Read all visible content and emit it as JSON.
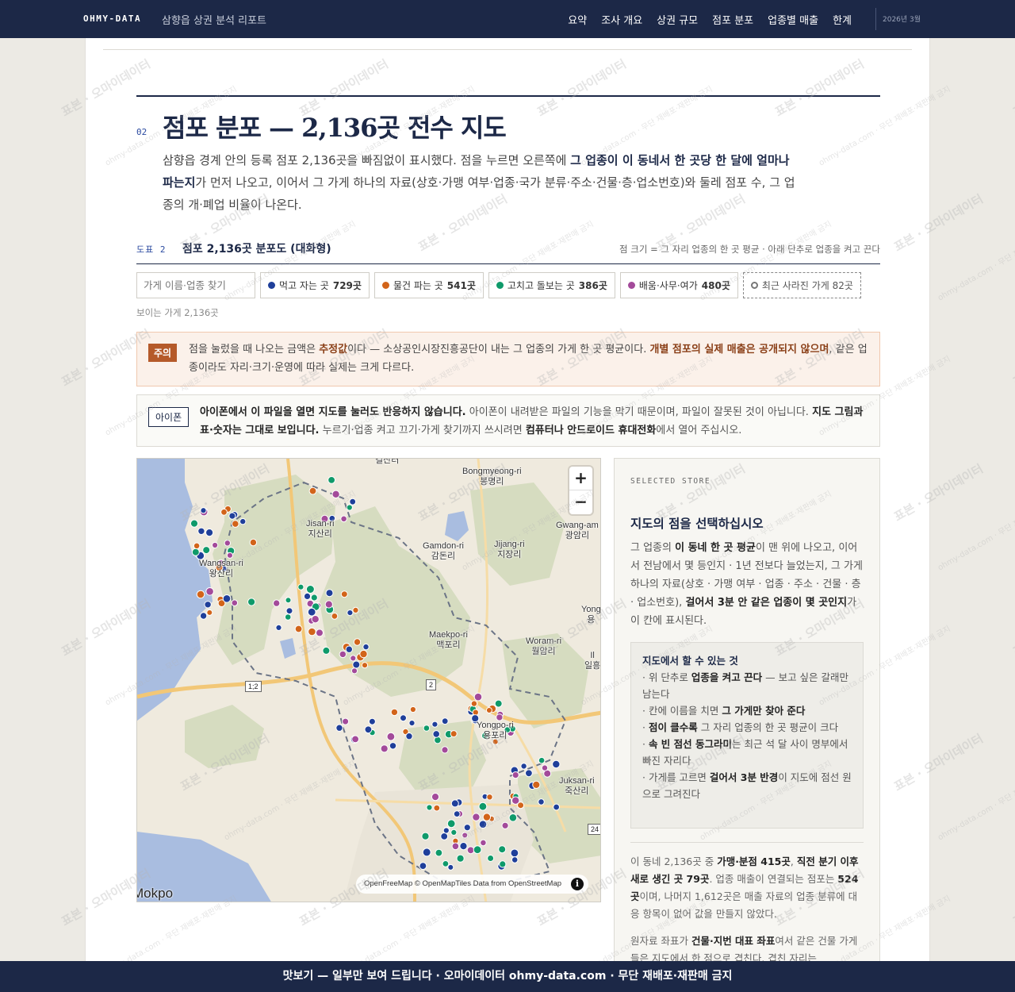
{
  "header": {
    "brand": "OHMY-DATA",
    "report_title": "삼향읍 상권 분석 리포트",
    "nav": [
      "요약",
      "조사 개요",
      "상권 규모",
      "점포 분포",
      "업종별 매출",
      "한계"
    ],
    "date": "2026년 3월"
  },
  "section": {
    "number": "02",
    "title": "점포 분포 — 2,136곳 전수 지도",
    "lead_1": "삼향읍 경계 안의 등록 점포 2,136곳을 빠짐없이 표시했다. 점을 누르면 오른쪽에 ",
    "lead_b1": "그 업종이 이 동네서 한 곳당 한 달에 얼마나 파는지",
    "lead_2": "가 먼저 나오고, 이어서 그 가게 하나의 자료(상호·가맹 여부·업종·국가 분류·주소·건물·층·업소번호)와 둘레 점포 수, 그 업종의 개·폐업 비율이 나온다."
  },
  "figure": {
    "number": "도표 2",
    "title": "점포 2,136곳 분포도 (대화형)",
    "note": "점 크기 = 그 자리 업종의 한 곳 평균 · 아래 단추로 업종을 켜고 끈다"
  },
  "controls": {
    "search_placeholder": "가게 이름·업종 찾기",
    "filters": [
      {
        "label": "먹고 자는 곳",
        "count": "729곳",
        "color": "#1f3f9a"
      },
      {
        "label": "물건 파는 곳",
        "count": "541곳",
        "color": "#d2641a"
      },
      {
        "label": "고치고 돌보는 곳",
        "count": "386곳",
        "color": "#0f9a6a"
      },
      {
        "label": "배움·사무·여가",
        "count": "480곳",
        "color": "#a34a9a"
      }
    ],
    "closed_filter": "최근 사라진 가게 82곳",
    "visible_count": "보이는 가게 2,136곳"
  },
  "caution": {
    "tag": "주의",
    "t1": "점을 눌렀을 때 나오는 금액은 ",
    "b1": "추정값",
    "t2": "이다 — 소상공인시장진흥공단이 내는 그 업종의 가게 한 곳 평균이다. ",
    "b2": "개별 점포의 실제 매출은 공개되지 않으며",
    "t3": ", 같은 업종이라도 자리·크기·운영에 따라 실제는 크게 다르다."
  },
  "iphone": {
    "tag": "아이폰",
    "b1": "아이폰에서 이 파일을 열면 지도를 눌러도 반응하지 않습니다.",
    "t1": " 아이폰이 내려받은 파일의 기능을 막기 때문이며, 파일이 잘못된 것이 아닙니다. ",
    "b2": "지도 그림과 표·숫자는 그대로 보입니다.",
    "t2": " 누르기·업종 켜고 끄기·가게 찾기까지 쓰시려면 ",
    "b3": "컴퓨터나 안드로이드 휴대전화",
    "t3": "에서 열어 주십시오."
  },
  "map": {
    "zoom_in": "+",
    "zoom_out": "−",
    "attribution": "OpenFreeMap © OpenMapTiles Data from OpenStreetMap",
    "places": [
      {
        "en": "Jisan-ri",
        "ko": "지산리"
      },
      {
        "en": "Wangsan-ri",
        "ko": "왕산리"
      },
      {
        "en": "Bongmyeong-ri",
        "ko": "봉명리"
      },
      {
        "en": "Gamdon-ri",
        "ko": "감돈리"
      },
      {
        "en": "Jijang-ri",
        "ko": "지장리"
      },
      {
        "en": "Gwang-am",
        "ko": "광암리"
      },
      {
        "en": "Maekpo-ri",
        "ko": "맥포리"
      },
      {
        "en": "Woram-ri",
        "ko": "월암리"
      },
      {
        "en": "Yongpo-ri",
        "ko": "용포리"
      },
      {
        "en": "Juksan-ri",
        "ko": "죽산리"
      },
      {
        "en": "Yong",
        "ko": "용"
      },
      {
        "en": "Il",
        "ko": "일흥"
      }
    ],
    "city": "Mokpo",
    "top_label": "결산터",
    "shields": [
      "1;2",
      "2",
      "24"
    ]
  },
  "side": {
    "eyebrow": "SELECTED STORE",
    "title": "지도의 점을 선택하십시오",
    "d1": "그 업종의 ",
    "db1": "이 동네 한 곳 평균",
    "d2": "이 맨 위에 나오고, 이어서 전남에서 몇 등인지 · 1년 전보다 늘었는지, 그 가게 하나의 자료(상호 · 가맹 여부 · 업종 · 주소 · 건물 · 층 · 업소번호), ",
    "db2": "걸어서 3분 안 같은 업종이 몇 곳인지",
    "d3": "가 이 칸에 표시된다.",
    "howto_title": "지도에서 할 수 있는 것",
    "h1a": "· 위 단추로 ",
    "h1b": "업종을 켜고 끈다",
    "h1c": " — 보고 싶은 갈래만 남는다",
    "h2a": "· 칸에 이름을 치면 ",
    "h2b": "그 가게만 찾아 준다",
    "h3a": "· ",
    "h3b": "점이 클수록",
    "h3c": " 그 자리 업종의 한 곳 평균이 크다",
    "h4a": "· ",
    "h4b": "속 빈 점선 동그라미",
    "h4c": "는 최근 석 달 사이 명부에서 빠진 자리다",
    "h5a": "· 가게를 고르면 ",
    "h5b": "걸어서 3분 반경",
    "h5c": "이 지도에 점선 원으로 그려진다",
    "s1": "이 동네 2,136곳 중 ",
    "sb1": "가맹·분점 415곳",
    "s2": ", ",
    "sb2": "직전 분기 이후 새로 생긴 곳 79곳",
    "s3": ". 업종 매출이 연결되는 점포는 ",
    "sb3": "524곳",
    "s4": "이며, 나머지 1,612곳은 매출 자료의 업종 분류에 대응 항목이 없어 값을 만들지 않았다.",
    "s5": "원자료 좌표가 ",
    "sb5": "건물·지번 대표 좌표",
    "s6": "여서 같은 건물 가게들은 지도에서 한 점으로 겹친다. 겹친 자리는"
  },
  "watermark": {
    "main": "표본 · 오마이데이터",
    "sub": "ohmy-data.com · 무단 재배포·재판매 금지"
  },
  "footer": "맛보기 — 일부만 보여 드립니다 · 오마이데이터 ohmy-data.com · 무단 재배포·재판매 금지"
}
